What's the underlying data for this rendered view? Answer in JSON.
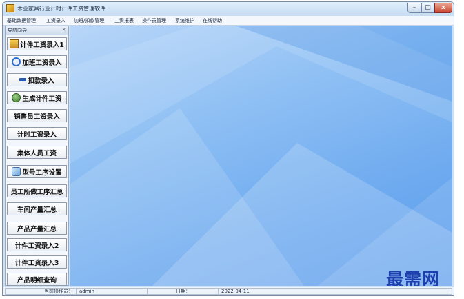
{
  "window": {
    "title": "木业家具行业计时计件工资管理软件"
  },
  "title_controls": {
    "minimize": "–",
    "maximize": "□",
    "close": "x"
  },
  "menu": [
    "基础数据管理",
    "工资录入",
    "加班/扣款管理",
    "工资报表",
    "操作员管理",
    "系统维护",
    "在线帮助"
  ],
  "nav": {
    "title": "导航向导",
    "collapse": "«",
    "buttons": [
      {
        "label": "计件工资录入1",
        "icon": "form-icon"
      },
      {
        "label": "加班工资录入",
        "icon": "clock-icon"
      },
      {
        "label": "扣款录入",
        "icon": "minus-icon"
      },
      {
        "label": "生成计件工资",
        "icon": "money-bag-icon"
      },
      {
        "label": "销售员工资录入",
        "icon": ""
      },
      {
        "label": "计时工资录入",
        "icon": ""
      },
      {
        "label": "集体人员工资",
        "icon": ""
      },
      {
        "label": "型号工序设置",
        "icon": "search-icon"
      },
      {
        "label": "员工所做工序汇总",
        "icon": ""
      },
      {
        "label": "车间产量汇总",
        "icon": ""
      },
      {
        "label": "产品产量汇总",
        "icon": ""
      },
      {
        "label": "计件工资录入2",
        "icon": ""
      },
      {
        "label": "计件工资录入3",
        "icon": ""
      },
      {
        "label": "产品明细查询",
        "icon": ""
      }
    ]
  },
  "watermark": "最需网",
  "status": {
    "operator_label": "当前操作员：",
    "operator_value": "admin",
    "date_label": "日期：",
    "date_value": "2022-04-11"
  },
  "colors": {
    "desktop_blue": "#6eaaef",
    "watermark": "#1e3fb0"
  }
}
